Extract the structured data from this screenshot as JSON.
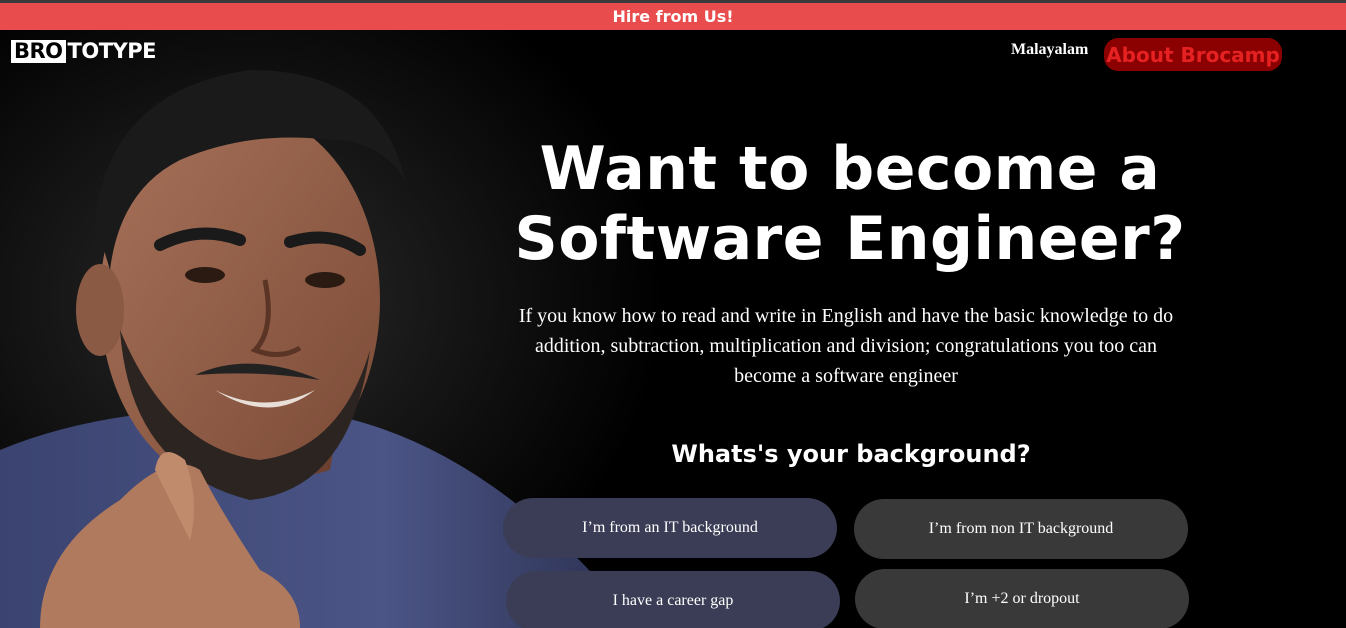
{
  "banner": {
    "label": "Hire from Us!"
  },
  "header": {
    "logo_boxed": "BRO",
    "logo_rest": "TOTYPE",
    "language_label": "Malayalam",
    "about_button_label": "About Brocamp"
  },
  "hero": {
    "headline_line1": "Want to become a",
    "headline_line2": "Software Engineer?",
    "description": "If you know how to read and write in English and have the basic knowledge to do addition, subtraction, multiplication and division; congratulations you too can become a software engineer",
    "question": "Whats's your background?",
    "options": [
      {
        "label": "I’m from an IT background"
      },
      {
        "label": "I’m from non IT background"
      },
      {
        "label": "I have a career gap"
      },
      {
        "label": "I’m +2 or dropout"
      }
    ]
  },
  "colors": {
    "banner_bg": "#e84c4c",
    "about_bg": "#8b0000",
    "about_text": "#e52121",
    "option_bg": "#393939"
  }
}
